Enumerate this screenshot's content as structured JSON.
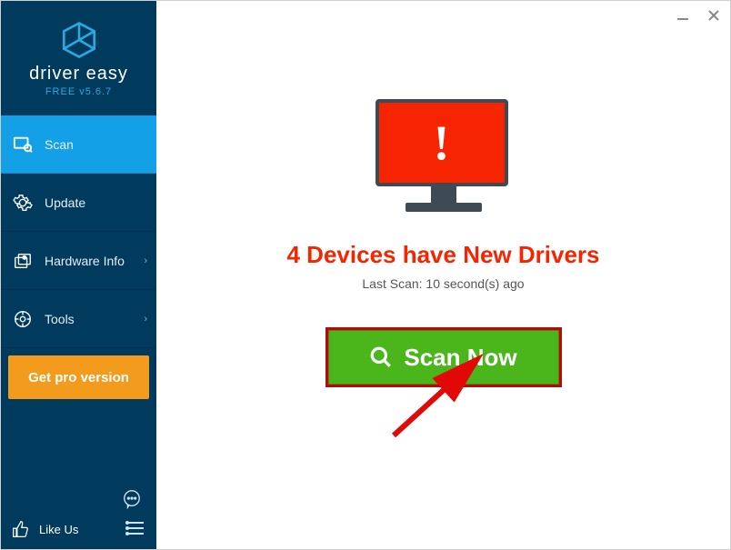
{
  "brand": "driver easy",
  "version": "FREE v5.6.7",
  "sidebar": {
    "items": [
      {
        "label": "Scan",
        "icon": "scan-icon",
        "active": true
      },
      {
        "label": "Update",
        "icon": "gear-icon"
      },
      {
        "label": "Hardware Info",
        "icon": "hardware-icon",
        "chevron": true
      },
      {
        "label": "Tools",
        "icon": "tools-icon",
        "chevron": true
      }
    ],
    "pro_label": "Get pro version",
    "like_label": "Like Us"
  },
  "main": {
    "headline": "4 Devices have New Drivers",
    "last_scan": "Last Scan: 10 second(s) ago",
    "scan_button": "Scan Now"
  }
}
